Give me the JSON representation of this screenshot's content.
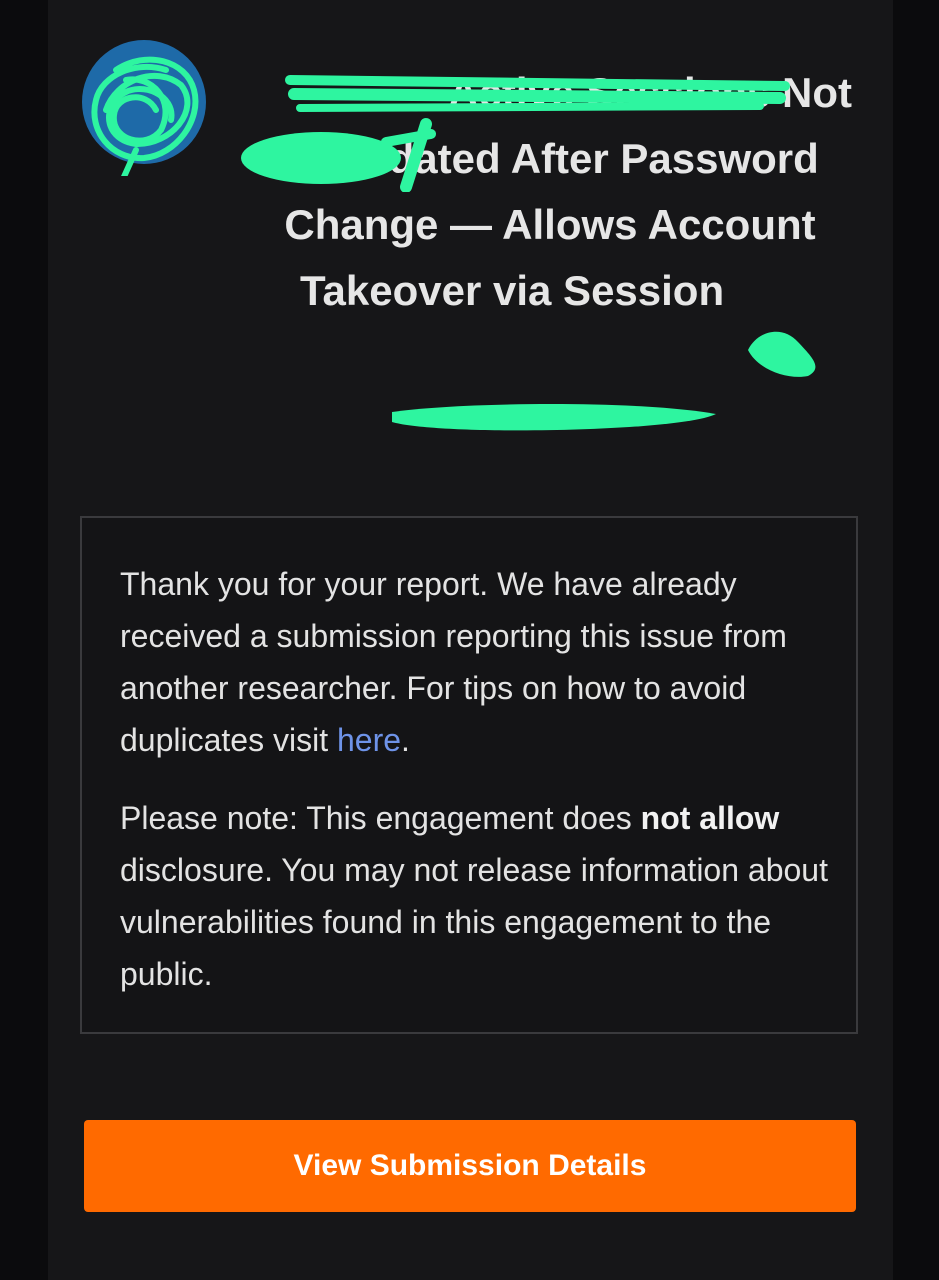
{
  "title": {
    "line1_visible": "Active Sessions Not",
    "line2": "Invalidated After Password",
    "line3": "Change — Allows Account",
    "line4_visible": "Takeover via Session"
  },
  "message": {
    "p1_text": "Thank you for your report. We have already received a submission reporting this issue from another researcher. For tips on how to avoid duplicates visit ",
    "p1_link": "here",
    "p1_end": ".",
    "p2_pre": "Please note: This engagement does ",
    "p2_bold": "not allow",
    "p2_post": " disclosure. You may not release information about vulnerabilities found in this engagement to the public."
  },
  "cta": {
    "label": "View Submission Details"
  },
  "colors": {
    "accent": "#ff6a00",
    "link": "#6e93e8",
    "redaction": "#2ef5a0",
    "avatar": "#1e6aa8"
  },
  "icons": {
    "avatar": "program-avatar-icon"
  }
}
